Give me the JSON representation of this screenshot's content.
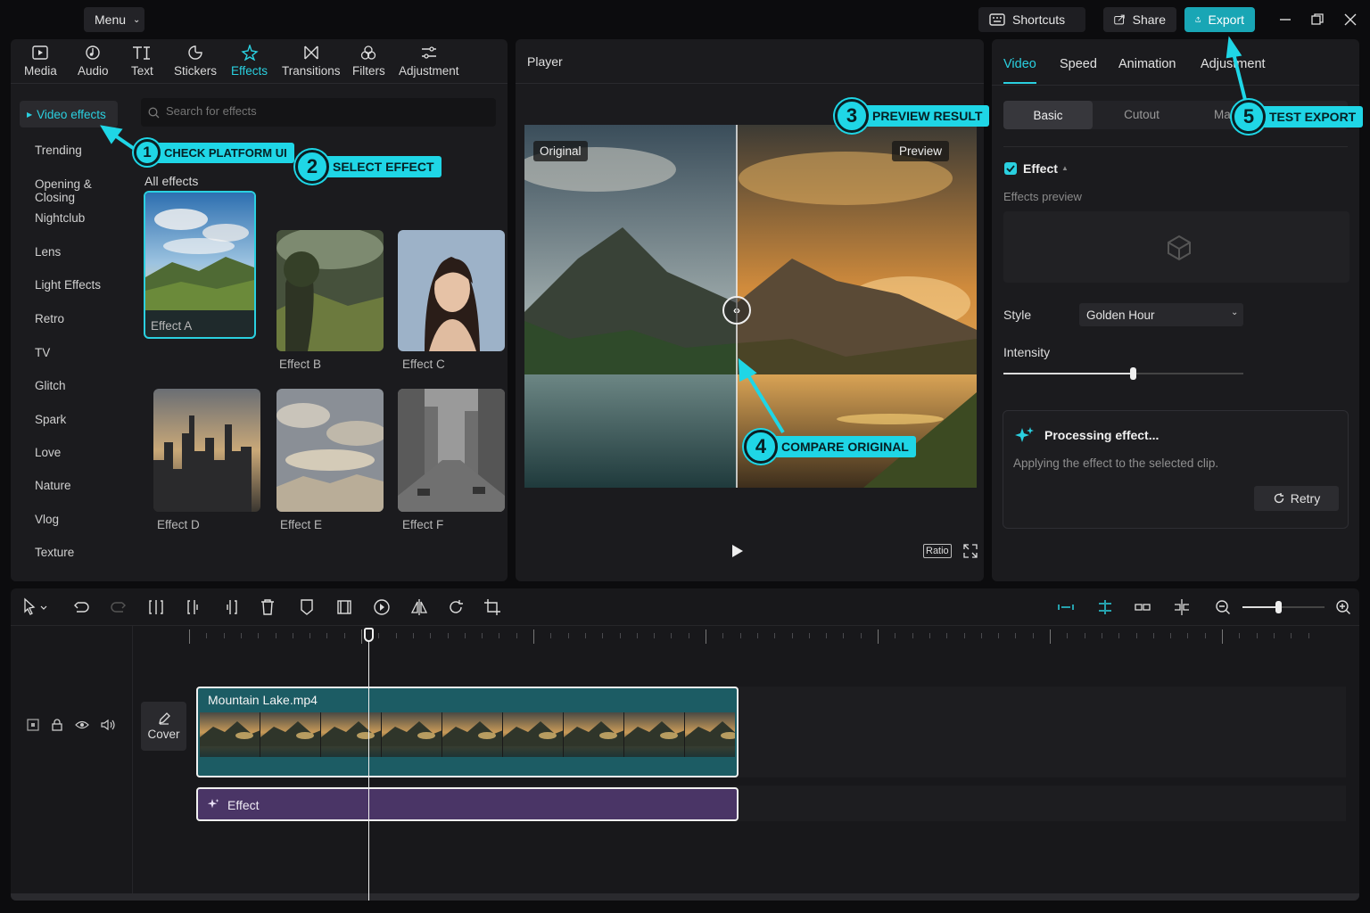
{
  "topbar": {
    "menu_label": "Menu",
    "shortcuts_label": "Shortcuts",
    "share_label": "Share",
    "export_label": "Export"
  },
  "tools": [
    {
      "label": "Media",
      "icon": "media-icon"
    },
    {
      "label": "Audio",
      "icon": "audio-icon"
    },
    {
      "label": "Text",
      "icon": "text-icon"
    },
    {
      "label": "Stickers",
      "icon": "stickers-icon"
    },
    {
      "label": "Effects",
      "icon": "effects-icon"
    },
    {
      "label": "Transitions",
      "icon": "transitions-icon"
    },
    {
      "label": "Filters",
      "icon": "filters-icon"
    },
    {
      "label": "Adjustment",
      "icon": "adjustment-icon"
    }
  ],
  "active_tool": "Effects",
  "sidebar": {
    "active": "Video effects",
    "items": [
      "Trending",
      "Opening & Closing",
      "Nightclub",
      "Lens",
      "Light Effects",
      "Retro",
      "TV",
      "Glitch",
      "Spark",
      "Love",
      "Nature",
      "Vlog",
      "Texture"
    ]
  },
  "effects_panel": {
    "search_placeholder": "Search for effects",
    "section_title": "All effects",
    "items": [
      "Effect A",
      "Effect B",
      "Effect C",
      "Effect D",
      "Effect E",
      "Effect F"
    ]
  },
  "player": {
    "title": "Player",
    "original_label": "Original",
    "preview_label": "Preview",
    "ratio_label": "Ratio"
  },
  "inspector": {
    "tabs": [
      "Video",
      "Speed",
      "Animation",
      "Adjustment"
    ],
    "subtabs": [
      "Basic",
      "Cutout",
      "Mask"
    ],
    "effect_label": "Effect",
    "effects_preview_label": "Effects preview",
    "style_label": "Style",
    "style_value": "Golden Hour",
    "intensity_label": "Intensity",
    "intensity_value": 0.54,
    "processing_title": "Processing effect...",
    "processing_desc": "Applying the effect to the selected clip.",
    "retry_label": "Retry"
  },
  "timeline": {
    "cover_label": "Cover",
    "clip_name": "Mountain Lake.mp4",
    "effect_clip_label": "Effect",
    "zoom_value": 0.43
  },
  "callouts": [
    {
      "num": "1",
      "text": "CHECK PLATFORM UI"
    },
    {
      "num": "2",
      "text": "SELECT EFFECT"
    },
    {
      "num": "3",
      "text": "PREVIEW RESULT"
    },
    {
      "num": "4",
      "text": "COMPARE ORIGINAL"
    },
    {
      "num": "5",
      "text": "TEST EXPORT"
    }
  ],
  "colors": {
    "accent": "#1fd6e6",
    "active_tab": "#2ad0e0",
    "export_button": "#19a6b5",
    "video_clip": "#1c5c64",
    "effect_clip": "#4a3566"
  }
}
